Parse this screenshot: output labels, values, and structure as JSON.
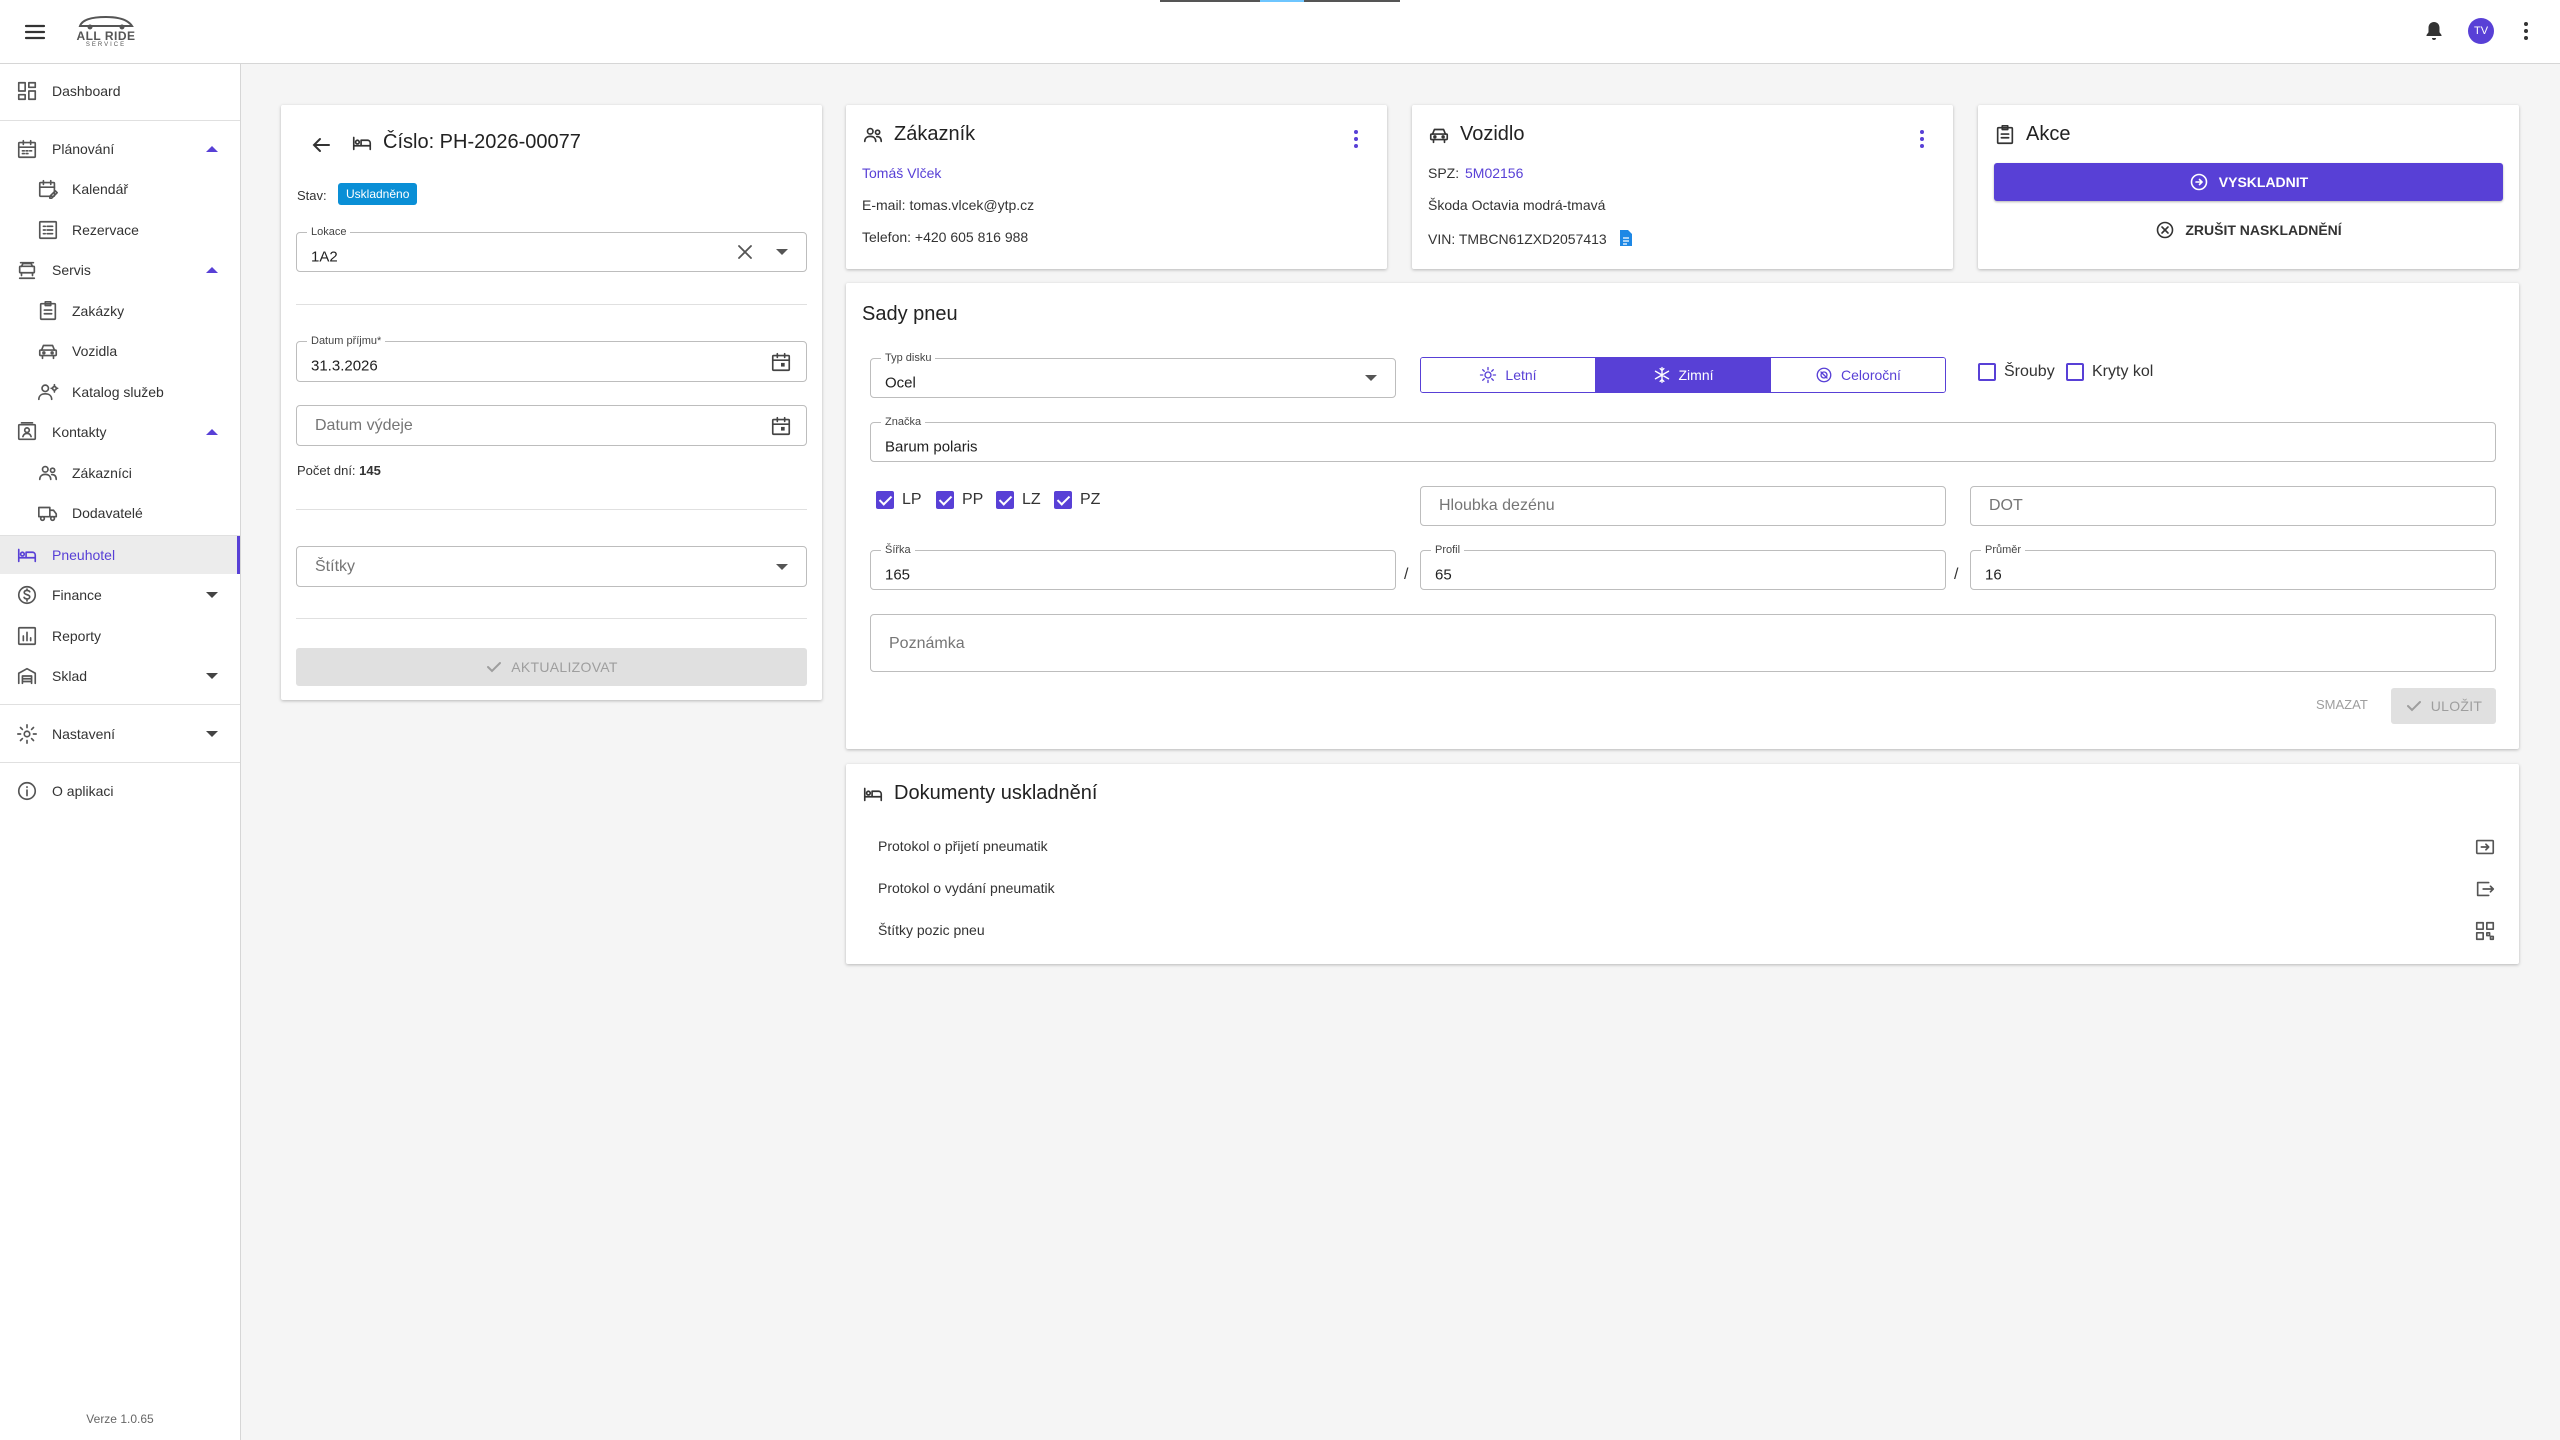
{
  "topbar": {
    "logo_text": "ALL RIDE",
    "logo_sub": "SERVICE",
    "avatar_initials": "TV"
  },
  "sidebar": {
    "items": [
      {
        "label": "Dashboard"
      },
      {
        "label": "Plánování"
      },
      {
        "label": "Kalendář"
      },
      {
        "label": "Rezervace"
      },
      {
        "label": "Servis"
      },
      {
        "label": "Zakázky"
      },
      {
        "label": "Vozidla"
      },
      {
        "label": "Katalog služeb"
      },
      {
        "label": "Kontakty"
      },
      {
        "label": "Zákazníci"
      },
      {
        "label": "Dodavatelé"
      },
      {
        "label": "Pneuhotel"
      },
      {
        "label": "Finance"
      },
      {
        "label": "Reporty"
      },
      {
        "label": "Sklad"
      },
      {
        "label": "Nastavení"
      },
      {
        "label": "O aplikaci"
      }
    ],
    "version": "Verze 1.0.65"
  },
  "detail": {
    "title": "Číslo: PH-2026-00077",
    "status_label": "Stav:",
    "status_badge": "Uskladněno",
    "location_label": "Lokace",
    "location_value": "1A2",
    "date_in_label": "Datum příjmu*",
    "date_in_value": "31.3.2026",
    "date_out_placeholder": "Datum výdeje",
    "days_label": "Počet dní:",
    "days_value": "145",
    "tags_placeholder": "Štítky",
    "update_button": "AKTUALIZOVAT"
  },
  "customer": {
    "title": "Zákazník",
    "name": "Tomáš Vlček",
    "email": "E-mail: tomas.vlcek@ytp.cz",
    "phone": "Telefon: +420 605 816 988"
  },
  "vehicle": {
    "title": "Vozidlo",
    "spz_label": "SPZ:",
    "spz_value": "5M02156",
    "model": "Škoda Octavia modrá-tmavá",
    "vin": "VIN: TMBCN61ZXD2057413"
  },
  "actions": {
    "title": "Akce",
    "primary": "VYSKLADNIT",
    "secondary": "ZRUŠIT NASKLADNĚNÍ"
  },
  "tires": {
    "title": "Sady pneu",
    "disk_label": "Typ disku",
    "disk_value": "Ocel",
    "seasons": [
      "Letní",
      "Zimní",
      "Celoroční"
    ],
    "screws": "Šrouby",
    "covers": "Kryty kol",
    "brand_label": "Značka",
    "brand_value": "Barum polaris",
    "positions": [
      "LP",
      "PP",
      "LZ",
      "PZ"
    ],
    "depth_placeholder": "Hloubka dezénu",
    "dot_placeholder": "DOT",
    "width_label": "Šířka",
    "width_value": "165",
    "profile_label": "Profil",
    "profile_value": "65",
    "diameter_label": "Průměr",
    "diameter_value": "16",
    "slash": "/",
    "note_placeholder": "Poznámka",
    "delete_button": "SMAZAT",
    "save_button": "ULOŽIT"
  },
  "documents": {
    "title": "Dokumenty uskladnění",
    "rows": [
      {
        "label": "Protokol o přijetí pneumatik"
      },
      {
        "label": "Protokol o vydání pneumatik"
      },
      {
        "label": "Štítky pozic pneu"
      }
    ]
  },
  "colors": {
    "accent": "#5840d6",
    "badge": "#0a8fd6"
  }
}
